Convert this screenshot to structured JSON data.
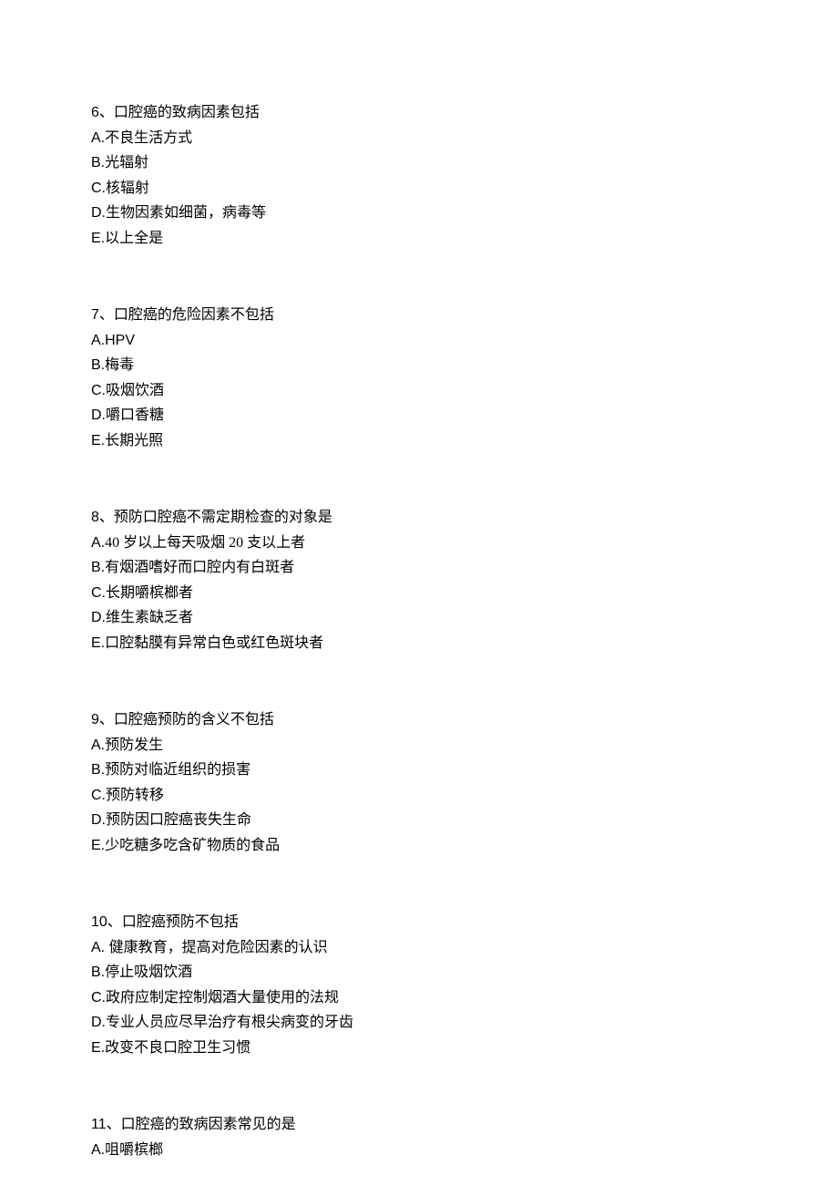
{
  "questions": [
    {
      "number": "6、",
      "stem": "口腔癌的致病因素包括",
      "options": [
        {
          "label": "A.",
          "text": "不良生活方式"
        },
        {
          "label": "B.",
          "text": "光辐射"
        },
        {
          "label": "C.",
          "text": "核辐射"
        },
        {
          "label": "D.",
          "text": "生物因素如细菌，病毒等"
        },
        {
          "label": "E.",
          "text": "以上全是"
        }
      ]
    },
    {
      "number": "7、",
      "stem": "口腔癌的危险因素不包括",
      "options": [
        {
          "label": "A.",
          "text": "HPV"
        },
        {
          "label": "B.",
          "text": "梅毒"
        },
        {
          "label": "C.",
          "text": "吸烟饮酒"
        },
        {
          "label": "D.",
          "text": "嚼口香糖"
        },
        {
          "label": "E.",
          "text": "长期光照"
        }
      ]
    },
    {
      "number": "8、",
      "stem": "预防口腔癌不需定期检查的对象是",
      "options": [
        {
          "label": "A.",
          "text": "40 岁以上每天吸烟 20 支以上者"
        },
        {
          "label": "B.",
          "text": "有烟酒嗜好而口腔内有白斑者"
        },
        {
          "label": "C.",
          "text": "长期嚼槟榔者"
        },
        {
          "label": "D.",
          "text": "维生素缺乏者"
        },
        {
          "label": "E.",
          "text": "口腔黏膜有异常白色或红色斑块者"
        }
      ]
    },
    {
      "number": "9、",
      "stem": "口腔癌预防的含义不包括",
      "options": [
        {
          "label": "A.",
          "text": "预防发生"
        },
        {
          "label": "B.",
          "text": "预防对临近组织的损害"
        },
        {
          "label": "C.",
          "text": "预防转移"
        },
        {
          "label": "D.",
          "text": "预防因口腔癌丧失生命"
        },
        {
          "label": "E.",
          "text": "少吃糖多吃含矿物质的食品"
        }
      ]
    },
    {
      "number": "10、",
      "stem": "口腔癌预防不包括",
      "options": [
        {
          "label": "A. ",
          "text": "健康教育，提高对危险因素的认识"
        },
        {
          "label": "B.",
          "text": "停止吸烟饮酒"
        },
        {
          "label": "C.",
          "text": "政府应制定控制烟酒大量使用的法规"
        },
        {
          "label": "D.",
          "text": "专业人员应尽早治疗有根尖病变的牙齿"
        },
        {
          "label": "E.",
          "text": "改变不良口腔卫生习惯"
        }
      ]
    },
    {
      "number": "11、",
      "stem": "口腔癌的致病因素常见的是",
      "options": [
        {
          "label": "A.",
          "text": "咀嚼槟榔"
        }
      ]
    }
  ]
}
